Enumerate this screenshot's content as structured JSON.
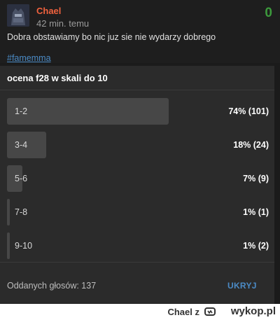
{
  "post": {
    "author": "Chael",
    "time": "42 min. temu",
    "score": "0",
    "content": "Dobra obstawiamy bo nic juz sie nie wydarzy dobrego",
    "tag": "#famemma"
  },
  "poll": {
    "title": "ocena f28 w skali do 10",
    "options": [
      {
        "label": "1-2",
        "result": "74% (101)",
        "percent": 74
      },
      {
        "label": "3-4",
        "result": "18% (24)",
        "percent": 18
      },
      {
        "label": "5-6",
        "result": "7% (9)",
        "percent": 7
      },
      {
        "label": "7-8",
        "result": "1% (1)",
        "percent": 1
      },
      {
        "label": "9-10",
        "result": "1% (2)",
        "percent": 1
      }
    ],
    "votes_label": "Oddanych głosów: 137",
    "hide_label": "UKRYJ"
  },
  "footer": {
    "user": "Chael",
    "user_suffix": "z",
    "logo": "wykop.pl"
  },
  "colors": {
    "author": "#f0623e",
    "score": "#3c9a3c",
    "link": "#4b8bc6"
  }
}
